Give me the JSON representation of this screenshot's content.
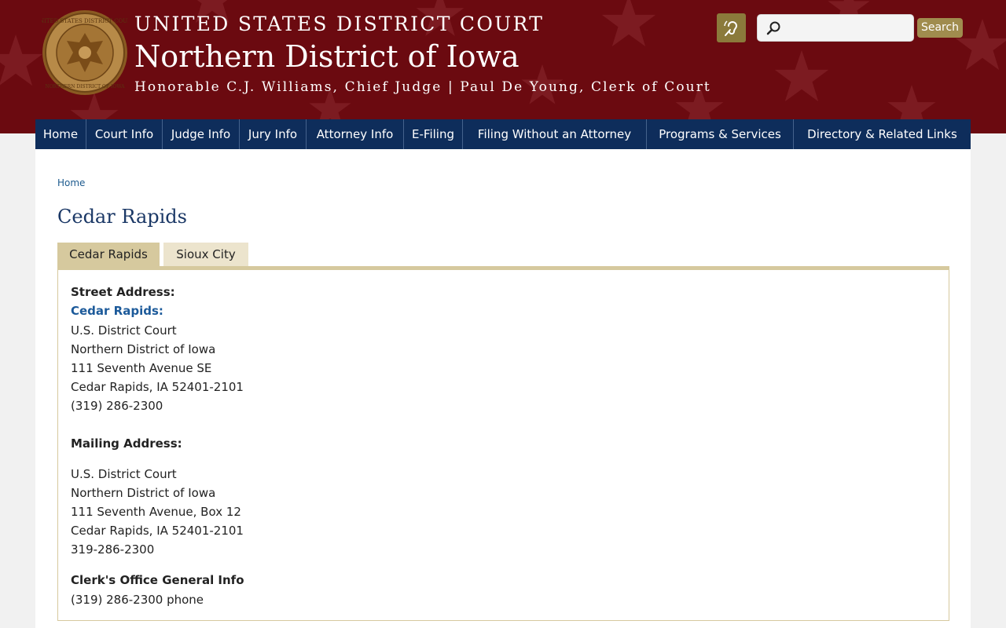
{
  "header": {
    "title_small": "UNITED STATES DISTRICT COURT",
    "title_big": "Northern District of Iowa",
    "judges": "Honorable C.J. Williams, Chief Judge | Paul De Young, Clerk of Court",
    "seal_text": "UNITED STATES DISTRICT COURT · NORTHERN DISTRICT OF IOWA",
    "search_placeholder": "",
    "search_button": "Search",
    "colors": {
      "banner": "#6b0a10",
      "accent": "#a08c4e",
      "nav": "#0e2d5b"
    }
  },
  "nav": {
    "items": [
      {
        "label": "Home"
      },
      {
        "label": "Court Info"
      },
      {
        "label": "Judge Info"
      },
      {
        "label": "Jury Info"
      },
      {
        "label": "Attorney Info"
      },
      {
        "label": "E-Filing"
      },
      {
        "label": "Filing Without an Attorney"
      },
      {
        "label": "Programs & Services"
      },
      {
        "label": "Directory & Related Links"
      }
    ]
  },
  "breadcrumb": {
    "home": "Home"
  },
  "page": {
    "title": "Cedar Rapids"
  },
  "tabs": [
    {
      "label": "Cedar Rapids",
      "active": true
    },
    {
      "label": "Sioux City",
      "active": false
    }
  ],
  "panel": {
    "street_label": "Street Address:",
    "street_city_link": "Cedar Rapids:",
    "street_lines": [
      "U.S. District Court",
      "Northern District of Iowa",
      "111 Seventh Avenue SE",
      "Cedar Rapids, IA 52401-2101",
      "(319) 286-2300"
    ],
    "mailing_label": "Mailing Address:",
    "mailing_lines": [
      "U.S. District Court",
      "Northern District of Iowa",
      "111 Seventh Avenue, Box 12",
      "Cedar Rapids, IA 52401-2101",
      "319-286-2300"
    ],
    "clerk_label": "Clerk's Office General Info",
    "clerk_phone": "(319) 286-2300 phone"
  }
}
